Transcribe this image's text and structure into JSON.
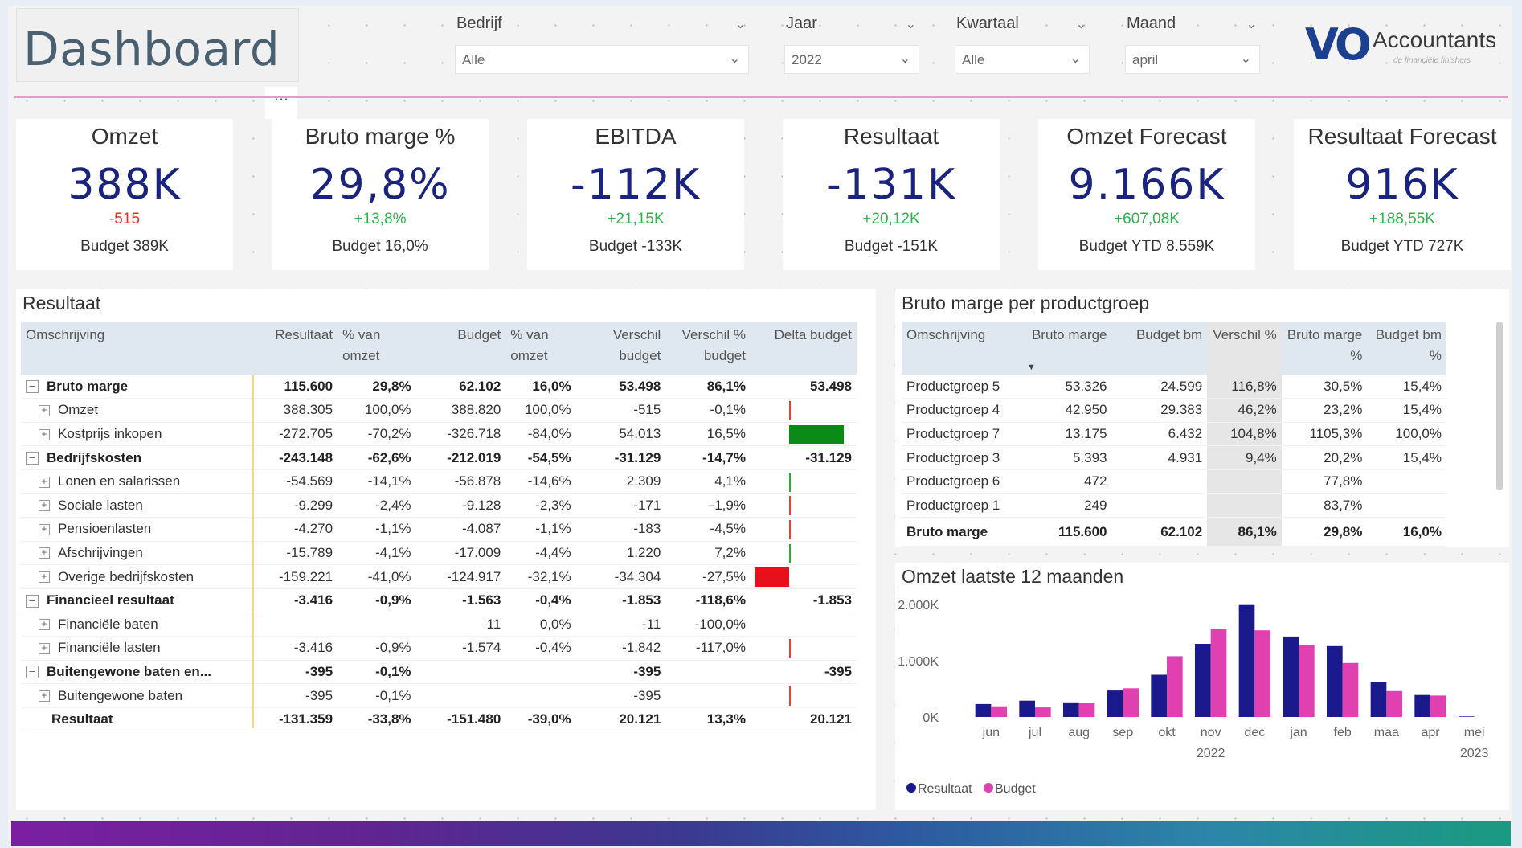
{
  "header": {
    "title": "Dashboard",
    "more": "...",
    "logo_mark": "VO",
    "logo_text": "Accountants",
    "logo_sub": "de financiële finishers"
  },
  "slicers": [
    {
      "label": "Bedrijf",
      "value": "Alle"
    },
    {
      "label": "Jaar",
      "value": "2022"
    },
    {
      "label": "Kwartaal",
      "value": "Alle"
    },
    {
      "label": "Maand",
      "value": "april"
    }
  ],
  "kpis": [
    {
      "title": "Omzet",
      "value": "388K",
      "delta": "-515",
      "delta_sign": "neg",
      "budget": "Budget 389K"
    },
    {
      "title": "Bruto marge %",
      "value": "29,8%",
      "delta": "+13,8%",
      "delta_sign": "pos",
      "budget": "Budget 16,0%"
    },
    {
      "title": "EBITDA",
      "value": "-112K",
      "delta": "+21,15K",
      "delta_sign": "pos",
      "budget": "Budget -133K"
    },
    {
      "title": "Resultaat",
      "value": "-131K",
      "delta": "+20,12K",
      "delta_sign": "pos",
      "budget": "Budget -151K"
    },
    {
      "title": "Omzet Forecast",
      "value": "9.166K",
      "delta": "+607,08K",
      "delta_sign": "pos",
      "budget": "Budget YTD 8.559K"
    },
    {
      "title": "Resultaat Forecast",
      "value": "916K",
      "delta": "+188,55K",
      "delta_sign": "pos",
      "budget": "Budget YTD 727K"
    }
  ],
  "resultaat": {
    "title": "Resultaat",
    "headers": [
      "Omschrijving",
      "Resultaat",
      "% van omzet",
      "Budget",
      "% van omzet",
      "Verschil budget",
      "Verschil % budget",
      "Delta budget"
    ],
    "rows": [
      {
        "name": "Bruto marge",
        "level": 0,
        "bold": true,
        "cells": [
          "115.600",
          "29,8%",
          "62.102",
          "16,0%",
          "53.498",
          "86,1%",
          "53.498"
        ],
        "bar": 0
      },
      {
        "name": "Omzet",
        "level": 1,
        "bold": false,
        "cells": [
          "388.305",
          "100,0%",
          "388.820",
          "100,0%",
          "-515",
          "-0,1%",
          ""
        ],
        "bar": -0.01
      },
      {
        "name": "Kostprijs inkopen",
        "level": 1,
        "bold": false,
        "cells": [
          "-272.705",
          "-70,2%",
          "-326.718",
          "-84,0%",
          "54.013",
          "16,5%",
          ""
        ],
        "bar": 54013
      },
      {
        "name": "Bedrijfskosten",
        "level": 0,
        "bold": true,
        "cells": [
          "-243.148",
          "-62,6%",
          "-212.019",
          "-54,5%",
          "-31.129",
          "-14,7%",
          "-31.129"
        ],
        "bar": 0
      },
      {
        "name": "Lonen en salarissen",
        "level": 1,
        "bold": false,
        "cells": [
          "-54.569",
          "-14,1%",
          "-56.878",
          "-14,6%",
          "2.309",
          "4,1%",
          ""
        ],
        "bar": 2309
      },
      {
        "name": "Sociale lasten",
        "level": 1,
        "bold": false,
        "cells": [
          "-9.299",
          "-2,4%",
          "-9.128",
          "-2,3%",
          "-171",
          "-1,9%",
          ""
        ],
        "bar": -171
      },
      {
        "name": "Pensioenlasten",
        "level": 1,
        "bold": false,
        "cells": [
          "-4.270",
          "-1,1%",
          "-4.087",
          "-1,1%",
          "-183",
          "-4,5%",
          ""
        ],
        "bar": -183
      },
      {
        "name": "Afschrijvingen",
        "level": 1,
        "bold": false,
        "cells": [
          "-15.789",
          "-4,1%",
          "-17.009",
          "-4,4%",
          "1.220",
          "7,2%",
          ""
        ],
        "bar": 1220
      },
      {
        "name": "Overige bedrijfskosten",
        "level": 1,
        "bold": false,
        "cells": [
          "-159.221",
          "-41,0%",
          "-124.917",
          "-32,1%",
          "-34.304",
          "-27,5%",
          ""
        ],
        "bar": -34304
      },
      {
        "name": "Financieel resultaat",
        "level": 0,
        "bold": true,
        "cells": [
          "-3.416",
          "-0,9%",
          "-1.563",
          "-0,4%",
          "-1.853",
          "-118,6%",
          "-1.853"
        ],
        "bar": 0
      },
      {
        "name": "Financiële baten",
        "level": 1,
        "bold": false,
        "cells": [
          "",
          "",
          "11",
          "0,0%",
          "-11",
          "-100,0%",
          ""
        ],
        "bar": 0
      },
      {
        "name": "Financiële lasten",
        "level": 1,
        "bold": false,
        "cells": [
          "-3.416",
          "-0,9%",
          "-1.574",
          "-0,4%",
          "-1.842",
          "-117,0%",
          ""
        ],
        "bar": -1842
      },
      {
        "name": "Buitengewone baten en...",
        "level": 0,
        "bold": true,
        "cells": [
          "-395",
          "-0,1%",
          "",
          "",
          "-395",
          "",
          "-395"
        ],
        "bar": 0
      },
      {
        "name": "Buitengewone baten",
        "level": 1,
        "bold": false,
        "cells": [
          "-395",
          "-0,1%",
          "",
          "",
          "-395",
          "",
          ""
        ],
        "bar": -395
      },
      {
        "name": "Resultaat",
        "level": 2,
        "bold": true,
        "cells": [
          "-131.359",
          "-33,8%",
          "-151.480",
          "-39,0%",
          "20.121",
          "13,3%",
          "20.121"
        ],
        "bar": 0
      }
    ]
  },
  "brutomarge": {
    "title": "Bruto marge per productgroep",
    "headers": [
      "Omschrijving",
      "Bruto marge",
      "Budget bm",
      "Verschil %",
      "Bruto marge %",
      "Budget bm %"
    ],
    "rows": [
      [
        "Productgroep 5",
        "53.326",
        "24.599",
        "116,8%",
        "30,5%",
        "15,4%"
      ],
      [
        "Productgroep 4",
        "42.950",
        "29.383",
        "46,2%",
        "23,2%",
        "15,4%"
      ],
      [
        "Productgroep 7",
        "13.175",
        "6.432",
        "104,8%",
        "1105,3%",
        "100,0%"
      ],
      [
        "Productgroep 3",
        "5.393",
        "4.931",
        "9,4%",
        "20,2%",
        "15,4%"
      ],
      [
        "Productgroep 6",
        "472",
        "",
        "",
        "77,8%",
        ""
      ],
      [
        "Productgroep 1",
        "249",
        "",
        "",
        "83,7%",
        ""
      ]
    ],
    "total": [
      "Bruto marge",
      "115.600",
      "62.102",
      "86,1%",
      "29,8%",
      "16,0%"
    ]
  },
  "chart_data": {
    "type": "bar",
    "title": "Omzet laatste 12 maanden",
    "categories": [
      "jun",
      "jul",
      "aug",
      "sep",
      "okt",
      "nov",
      "dec",
      "jan",
      "feb",
      "maa",
      "apr",
      "mei"
    ],
    "year_labels": [
      {
        "label": "2022",
        "at": "nov"
      },
      {
        "label": "2023",
        "at": "mei"
      }
    ],
    "ylim": [
      0,
      2000
    ],
    "yticks": [
      "0K",
      "1.000K",
      "2.000K"
    ],
    "ytick_values": [
      0,
      1000,
      2000
    ],
    "series": [
      {
        "name": "Resultaat",
        "color": "#1a1a8c",
        "values": [
          230,
          290,
          260,
          470,
          750,
          1300,
          1990,
          1430,
          1260,
          620,
          390,
          10
        ]
      },
      {
        "name": "Budget",
        "color": "#e040b0",
        "values": [
          190,
          170,
          250,
          510,
          1080,
          1560,
          1540,
          1280,
          960,
          460,
          380,
          0
        ]
      }
    ],
    "legend_position": "bottom-left",
    "grid": false
  },
  "colors": {
    "kpi_value": "#1a237e",
    "negative": "#e03030",
    "positive": "#30b050",
    "bar_green": "#0a8a16",
    "bar_red": "#e8101a"
  }
}
